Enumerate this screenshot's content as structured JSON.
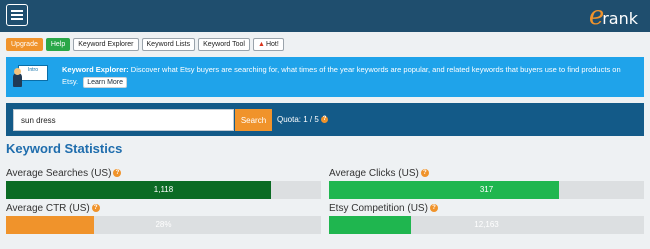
{
  "header": {
    "logo_initial": "e",
    "logo_rest": "rank"
  },
  "toolbar": {
    "upgrade": "Upgrade",
    "help": "Help",
    "keyword_explorer": "Keyword Explorer",
    "keyword_lists": "Keyword Lists",
    "keyword_tool": "Keyword Tool",
    "hot": "Hot!"
  },
  "banner": {
    "board_text": "Intro",
    "title": "Keyword Explorer:",
    "description": "Discover what Etsy buyers are searching for, what times of the year keywords are popular, and related keywords that buyers use to find products on Etsy.",
    "learn_more": "Learn More"
  },
  "search": {
    "value": "sun dress",
    "button": "Search",
    "quota": "Quota: 1 / 5"
  },
  "stats": {
    "title": "Keyword Statistics",
    "items": [
      {
        "label": "Average Searches (US)",
        "value": "1,118",
        "fill": 0.84,
        "color": "#0b6b24"
      },
      {
        "label": "Average Clicks (US)",
        "value": "317",
        "fill": 0.73,
        "color": "#1fb64f"
      },
      {
        "label": "Average CTR (US)",
        "value": "28%",
        "fill": 0.28,
        "color": "#f0932b"
      },
      {
        "label": "Etsy Competition (US)",
        "value": "12,163",
        "fill": 0.26,
        "color": "#1fb64f"
      }
    ]
  }
}
